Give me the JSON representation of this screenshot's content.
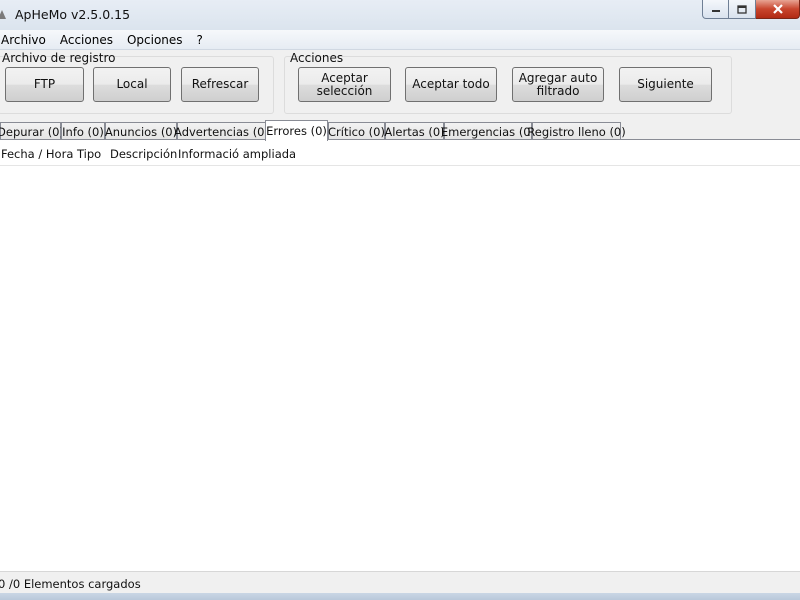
{
  "window": {
    "title": "ApHeMo v2.5.0.15",
    "icon": "app-icon",
    "controls": [
      "minimize-icon",
      "maximize-icon",
      "close-icon"
    ]
  },
  "menu": [
    "Archivo",
    "Acciones",
    "Opciones",
    "?"
  ],
  "log_group": {
    "label": "Archivo de registro",
    "buttons": [
      "FTP",
      "Local",
      "Refrescar"
    ]
  },
  "actions_group": {
    "label": "Acciones",
    "buttons": [
      "Aceptar selección",
      "Aceptar todo",
      "Agregar auto\nfiltrado",
      "Siguiente"
    ]
  },
  "tabs": [
    "Depurar (0)",
    "Info (0)",
    "Anuncios (0)",
    "Advertencias (0)",
    "Errores (0)",
    "Crítico (0)",
    "Alertas (0)",
    "Emergencias (0)",
    "Registro lleno (0)"
  ],
  "active_tab": "Errores (0)",
  "columns": [
    "Fecha / Hora",
    "Tipo",
    "Descripción",
    "Informació ampliada"
  ],
  "status": "0 /0 Elementos cargados",
  "colors": {
    "close_button": "#c8452d",
    "frame": "#dbe4ee",
    "tab_border": "#898c95"
  }
}
